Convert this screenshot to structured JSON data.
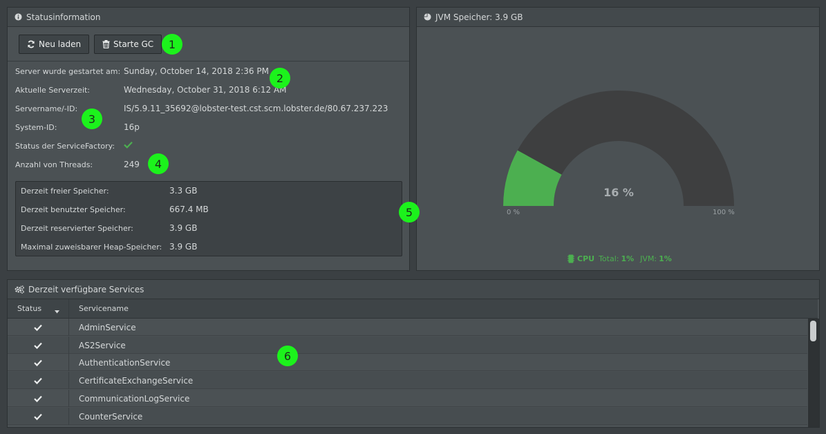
{
  "status_panel": {
    "title": "Statusinformation",
    "reload_label": "Neu laden",
    "gc_label": "Starte GC",
    "info": [
      {
        "label": "Server wurde gestartet am:",
        "value": "Sunday, October 14, 2018 2:36 PM"
      },
      {
        "label": "Aktuelle Serverzeit:",
        "value": "Wednesday, October 31, 2018 6:12 AM"
      },
      {
        "label": "Servername/-ID:",
        "value": "IS/5.9.11_35692@lobster-test.cst.scm.lobster.de/80.67.237.223"
      },
      {
        "label": "System-ID:",
        "value": "16p"
      },
      {
        "label": "Status der ServiceFactory:",
        "value": ""
      },
      {
        "label": "Anzahl von Threads:",
        "value": "249"
      }
    ],
    "memory": [
      {
        "label": "Derzeit freier Speicher:",
        "value": "3.3 GB"
      },
      {
        "label": "Derzeit benutzter Speicher:",
        "value": "667.4 MB"
      },
      {
        "label": "Derzeit reservierter Speicher:",
        "value": "3.9 GB"
      },
      {
        "label": "Maximal zuweisbarer Heap-Speicher:",
        "value": "3.9 GB"
      }
    ]
  },
  "jvm_panel": {
    "title": "JVM Speicher: 3.9 GB",
    "gauge_percent": 16,
    "gauge_label": "16 %",
    "min_label": "0 %",
    "max_label": "100 %",
    "cpu_label": "CPU",
    "total_label": "Total:",
    "total_value": "1%",
    "jvm_label": "JVM:",
    "jvm_value": "1%"
  },
  "services_panel": {
    "title": "Derzeit verfügbare Services",
    "col_status": "Status",
    "col_name": "Servicename",
    "rows": [
      {
        "name": "AdminService"
      },
      {
        "name": "AS2Service"
      },
      {
        "name": "AuthenticationService"
      },
      {
        "name": "CertificateExchangeService"
      },
      {
        "name": "CommunicationLogService"
      },
      {
        "name": "CounterService"
      }
    ]
  },
  "markers": [
    "1",
    "2",
    "3",
    "4",
    "5",
    "6"
  ],
  "colors": {
    "accent_green": "#4caf50",
    "marker_green": "#1cf21c",
    "gauge_bg": "#3e3f40"
  }
}
